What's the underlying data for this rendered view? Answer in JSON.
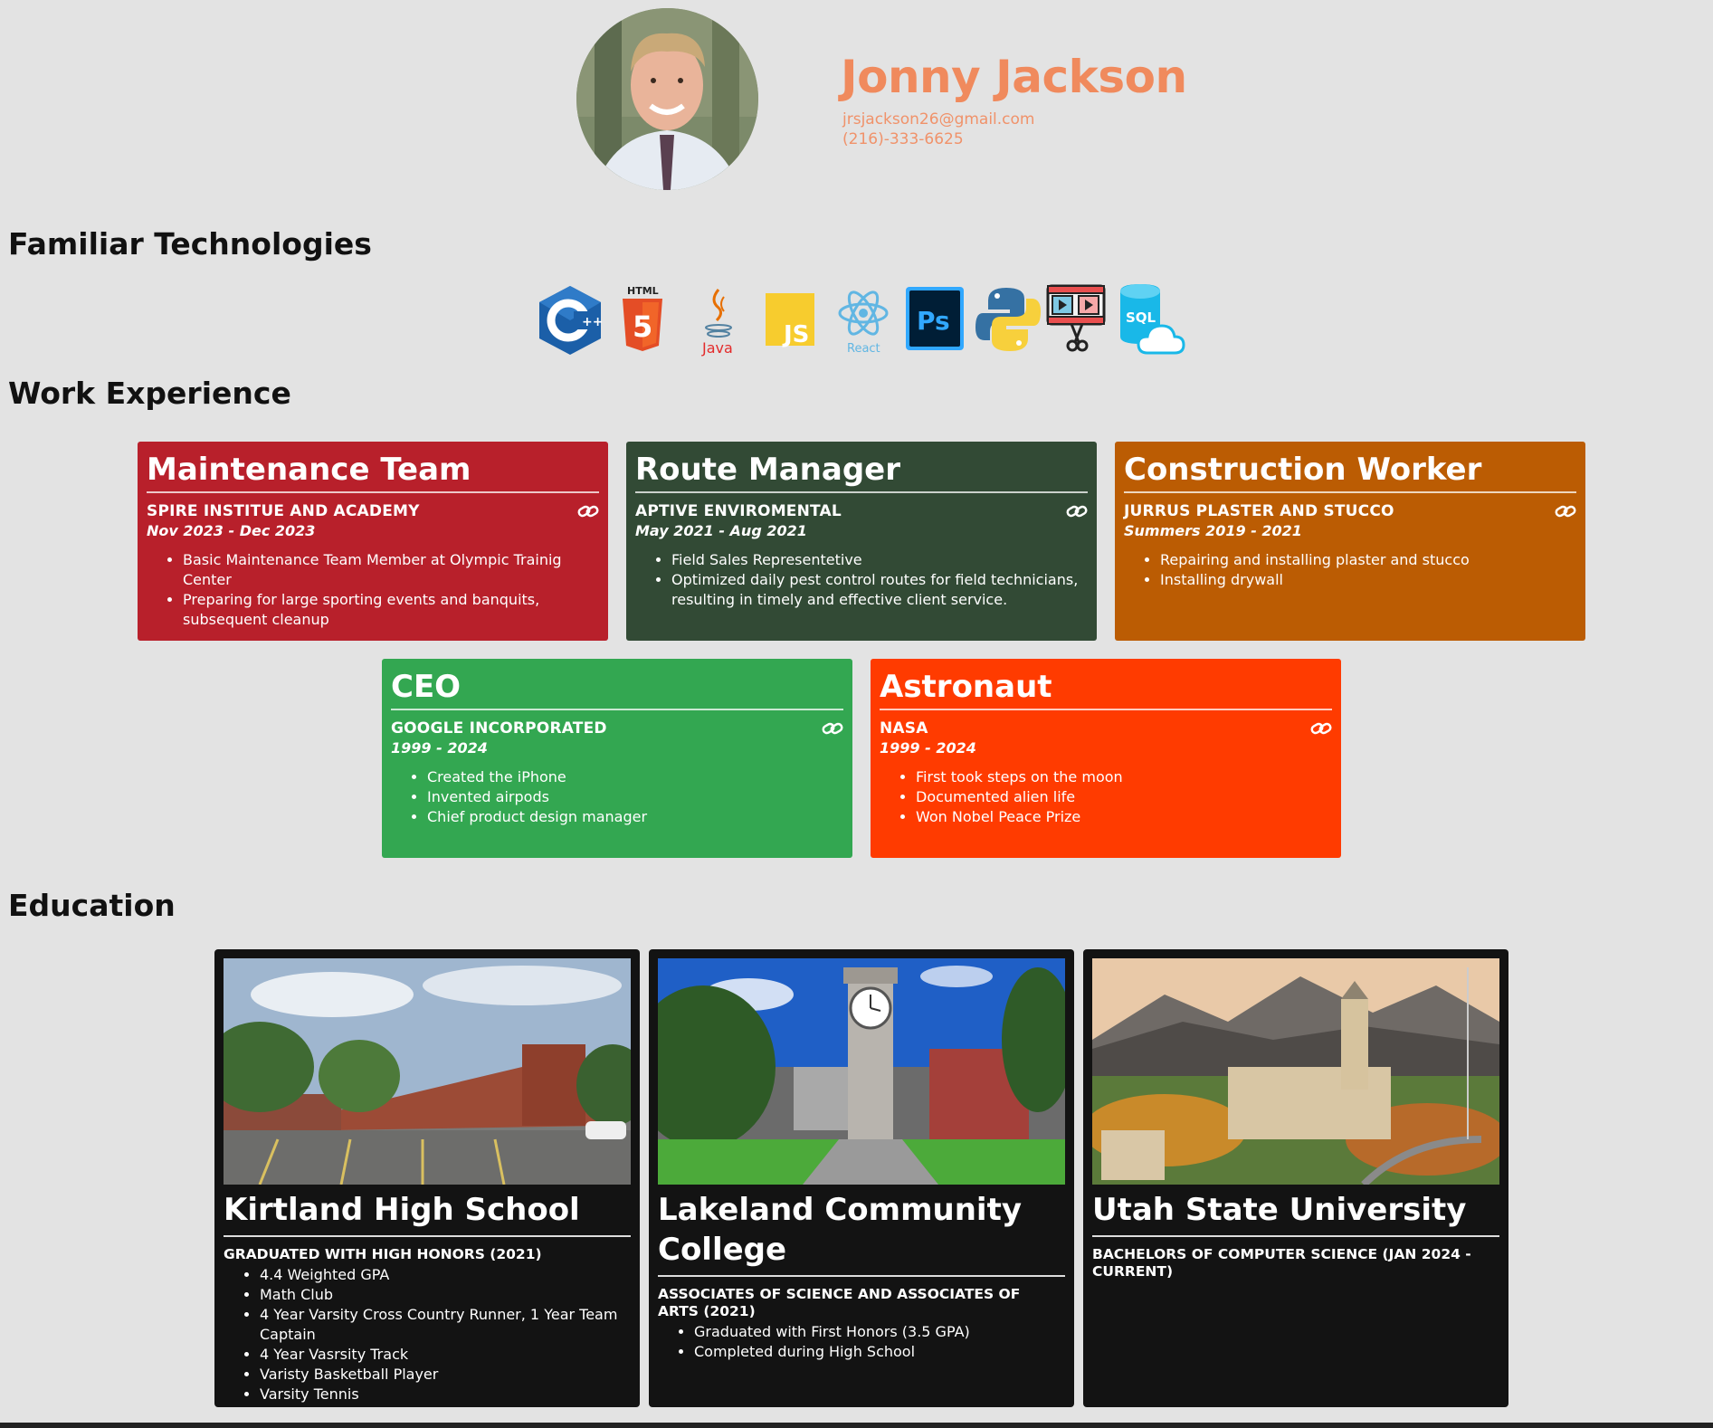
{
  "header": {
    "name": "Jonny Jackson",
    "email": "jrsjackson26@gmail.com",
    "phone": "(216)-333-6625",
    "accent_color": "#f08a5d"
  },
  "sections": {
    "technologies": "Familiar Technologies",
    "work": "Work Experience",
    "education": "Education"
  },
  "technologies": [
    {
      "icon": "cpp-icon",
      "label": "C++"
    },
    {
      "icon": "html5-icon",
      "label": "HTML"
    },
    {
      "icon": "java-icon",
      "label": "Java"
    },
    {
      "icon": "javascript-icon",
      "label": "JS"
    },
    {
      "icon": "react-icon",
      "label": "React"
    },
    {
      "icon": "photoshop-icon",
      "label": "Ps"
    },
    {
      "icon": "python-icon",
      "label": ""
    },
    {
      "icon": "video-editor-icon",
      "label": ""
    },
    {
      "icon": "sql-cloud-icon",
      "label": "SQL"
    }
  ],
  "jobs": [
    {
      "title": "Maintenance Team",
      "company": "Spire Institue and Academy",
      "dates": "Nov 2023 - Dec 2023",
      "color": "#b8202b",
      "bullets": [
        "Basic Maintenance Team Member at Olympic Trainig Center",
        "Preparing for large sporting events and banquits, subsequent cleanup"
      ]
    },
    {
      "title": "Route Manager",
      "company": "Aptive Enviromental",
      "dates": "May 2021 - Aug 2021",
      "color": "#324a35",
      "bullets": [
        "Field Sales Representetive",
        "Optimized daily pest control routes for field technicians, resulting in timely and effective client service."
      ]
    },
    {
      "title": "Construction Worker",
      "company": "Jurrus Plaster and Stucco",
      "dates": "Summers 2019 - 2021",
      "color": "#bb5c03",
      "bullets": [
        "Repairing and installing plaster and stucco",
        "Installing drywall"
      ]
    },
    {
      "title": "CEO",
      "company": "Google Incorporated",
      "dates": "1999 - 2024",
      "color": "#33a751",
      "bullets": [
        "Created the iPhone",
        "Invented airpods",
        "Chief product design manager"
      ]
    },
    {
      "title": "Astronaut",
      "company": "NASA",
      "dates": "1999 - 2024",
      "color": "#ff3b00",
      "bullets": [
        "First took steps on the moon",
        "Documented alien life",
        "Won Nobel Peace Prize"
      ]
    }
  ],
  "education": [
    {
      "school": "Kirtland High School",
      "degree": "Graduated with High Honors (2021)",
      "bullets": [
        "4.4 Weighted GPA",
        "Math Club",
        "4 Year Varsity Cross Country Runner, 1 Year Team Captain",
        "4 Year Vasrsity Track",
        "Varisty Basketball Player",
        "Varsity Tennis"
      ]
    },
    {
      "school": "Lakeland Community College",
      "degree": "Associates of Science and Associates of Arts (2021)",
      "bullets": [
        "Graduated with First Honors (3.5 GPA)",
        "Completed during High School"
      ]
    },
    {
      "school": "Utah State University",
      "degree": "Bachelors of Computer Science (Jan 2024 - Current)",
      "bullets": []
    }
  ]
}
